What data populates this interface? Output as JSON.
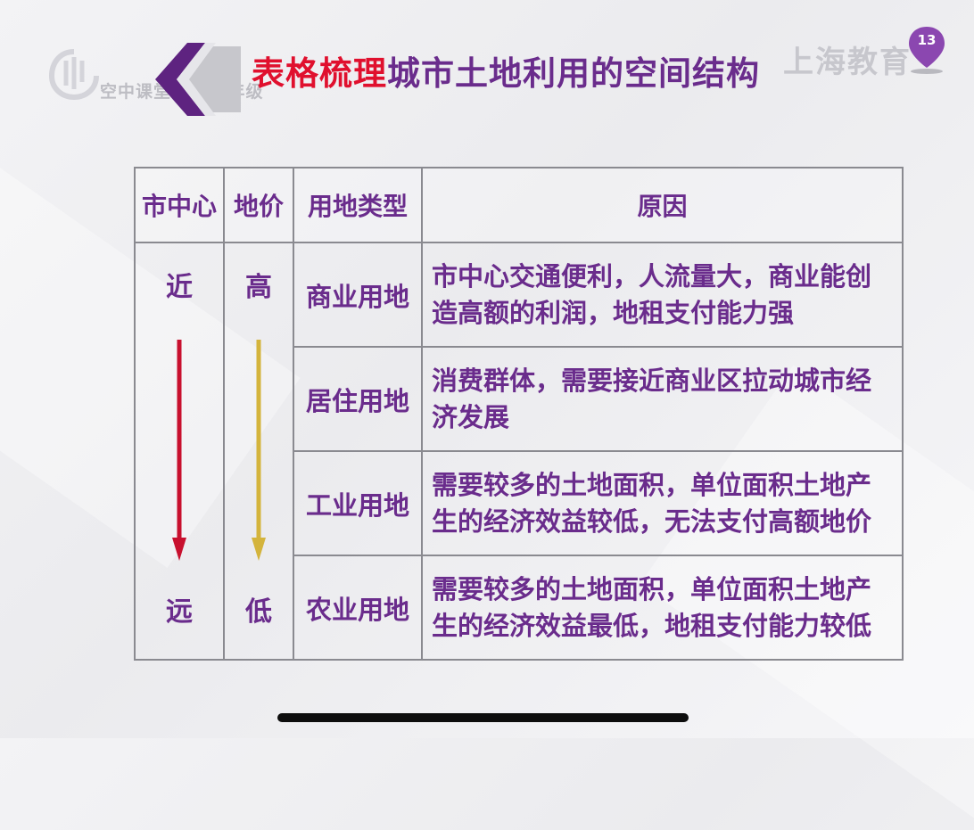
{
  "header": {
    "logo_caption": "空中课堂 · 高一年级",
    "title_highlight": "表格梳理",
    "title_rest": "城市土地利用的空间结构",
    "watermark": "上海教育",
    "page_number": "13"
  },
  "table": {
    "headers": [
      "市中心",
      "地价",
      "用地类型",
      "原因"
    ],
    "distance": {
      "top": "近",
      "bottom": "远"
    },
    "price": {
      "top": "高",
      "bottom": "低"
    },
    "rows": [
      {
        "type": "商业用地",
        "reason": "市中心交通便利，人流量大，商业能创造高额的利润，地租支付能力强"
      },
      {
        "type": "居住用地",
        "reason": "消费群体，需要接近商业区拉动城市经济发展"
      },
      {
        "type": "工业用地",
        "reason": "需要较多的土地面积，单位面积土地产生的经济效益较低，无法支付高额地价"
      },
      {
        "type": "农业用地",
        "reason": "需要较多的土地面积，单位面积土地产生的经济效益最低，地租支付能力较低"
      }
    ]
  },
  "colors": {
    "title_purple": "#6a2c8c",
    "title_red": "#e0102e",
    "arrow_red": "#c8102e",
    "arrow_gold": "#d4b43c"
  },
  "icons": {
    "logo": "shanghai-air-classroom-logo-icon",
    "chevron": "purple-chevron-icon",
    "badge": "location-pin-badge-icon"
  }
}
